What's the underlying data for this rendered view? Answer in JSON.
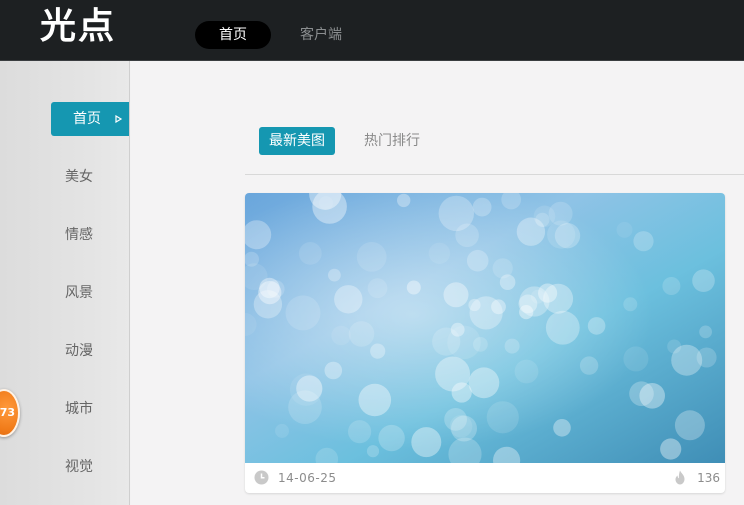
{
  "header": {
    "logo": "光点",
    "nav": [
      {
        "label": "首页",
        "active": true
      },
      {
        "label": "客户端",
        "active": false
      }
    ]
  },
  "sidebar": {
    "items": [
      {
        "label": "首页",
        "active": true,
        "icon": "play-arrow-icon"
      },
      {
        "label": "美女"
      },
      {
        "label": "情感"
      },
      {
        "label": "风景"
      },
      {
        "label": "动漫"
      },
      {
        "label": "城市"
      },
      {
        "label": "视觉"
      }
    ],
    "badge": "73"
  },
  "main": {
    "tabs": [
      {
        "label": "最新美图",
        "active": true
      },
      {
        "label": "热门排行",
        "active": false
      }
    ],
    "card": {
      "date": "14-06-25",
      "count": "136",
      "image": "blue-bokeh-photo"
    }
  },
  "colors": {
    "accent": "#1597b1",
    "topbar": "#1d2022",
    "badge": "#f07a18"
  }
}
